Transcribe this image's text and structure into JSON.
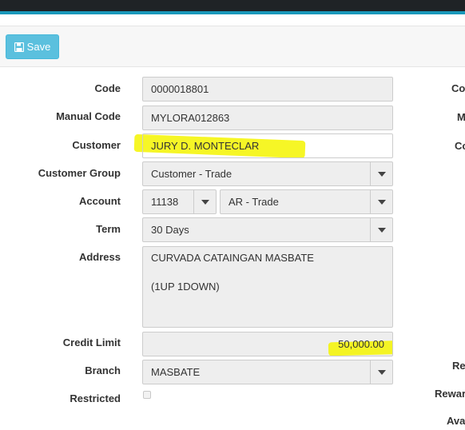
{
  "toolbar": {
    "save_label": "Save"
  },
  "form": {
    "code": {
      "label": "Code",
      "value": "0000018801"
    },
    "manual_code": {
      "label": "Manual Code",
      "value": "MYLORA012863"
    },
    "customer": {
      "label": "Customer",
      "value": "JURY D. MONTECLAR"
    },
    "customer_group": {
      "label": "Customer Group",
      "value": "Customer - Trade"
    },
    "account": {
      "label": "Account",
      "number": "11138",
      "name": "AR - Trade"
    },
    "term": {
      "label": "Term",
      "value": "30 Days"
    },
    "address": {
      "label": "Address",
      "value": "CURVADA CATAINGAN MASBATE\n\n(1UP 1DOWN)"
    },
    "credit_limit": {
      "label": "Credit Limit",
      "value": "50,000.00"
    },
    "branch": {
      "label": "Branch",
      "value": "MASBATE"
    },
    "restricted": {
      "label": "Restricted",
      "checked": false
    }
  },
  "right_column_labels": [
    "Co",
    "M",
    "Co",
    "Re",
    "Rewar",
    "Ava"
  ],
  "colors": {
    "highlight": "#f5f500",
    "save_button": "#5bc0de",
    "topbar": "#1f2326",
    "accent": "#1a98ba"
  }
}
